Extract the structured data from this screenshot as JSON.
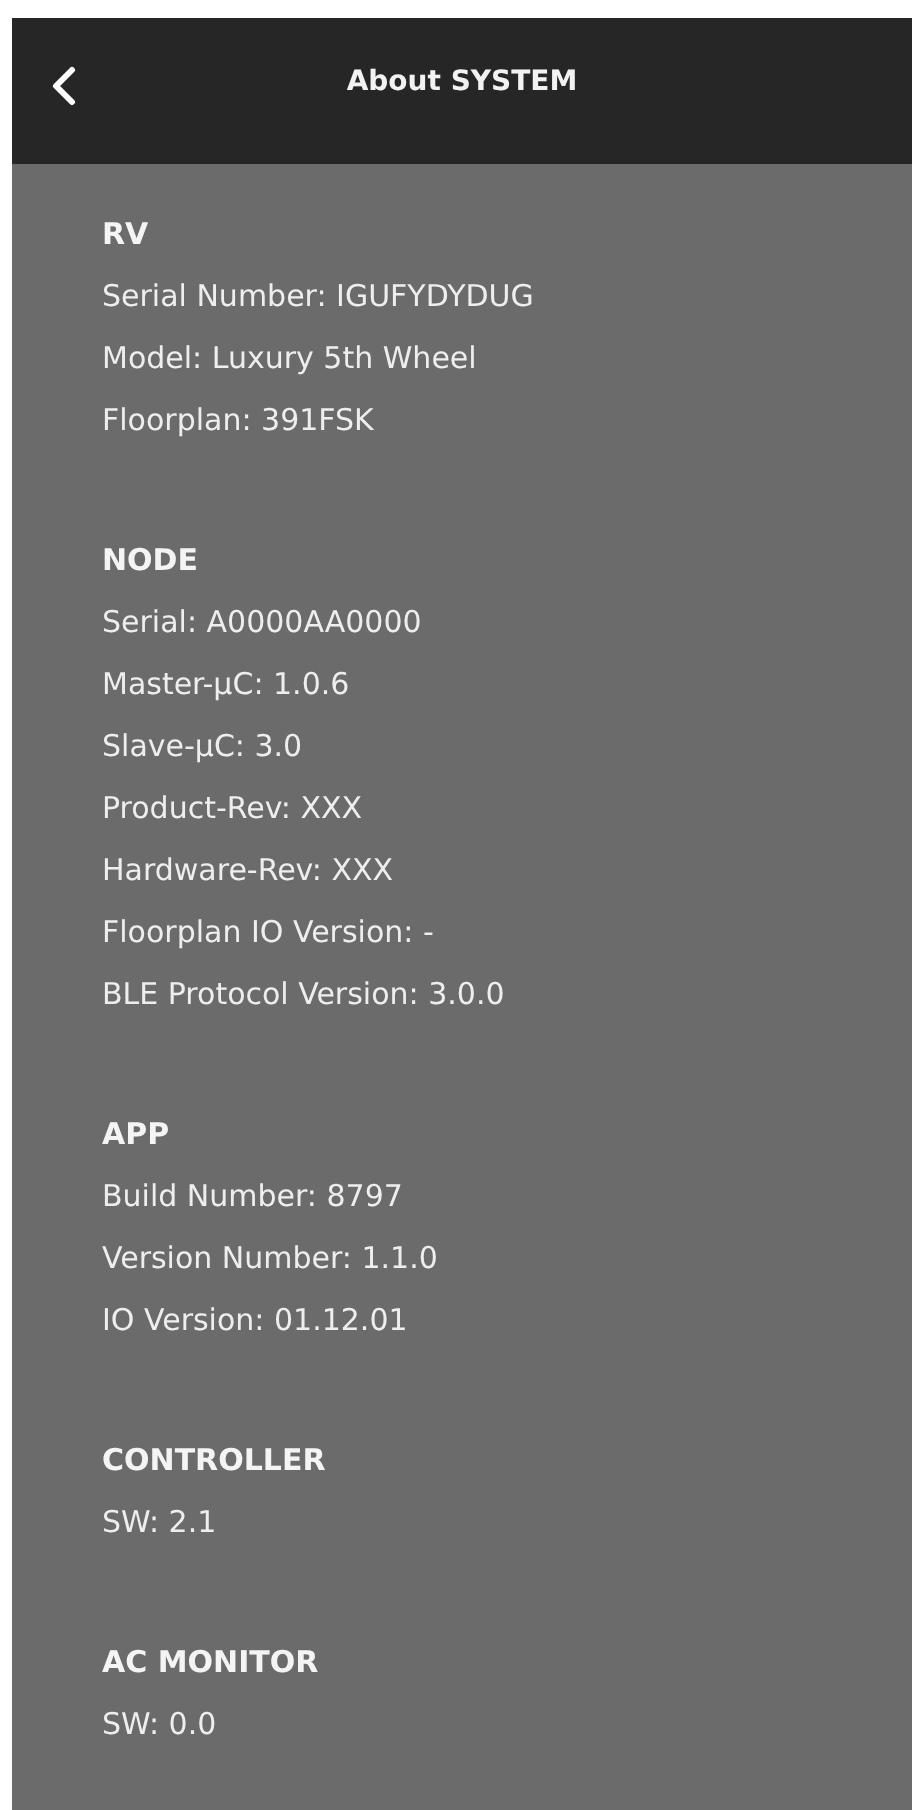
{
  "header": {
    "title": "About SYSTEM"
  },
  "sections": [
    {
      "title": "RV",
      "lines": [
        "Serial Number: IGUFYDYDUG",
        "Model: Luxury 5th Wheel",
        "Floorplan: 391FSK"
      ]
    },
    {
      "title": "NODE",
      "lines": [
        "Serial: A0000AA0000",
        "Master-µC: 1.0.6",
        "Slave-µC: 3.0",
        "Product-Rev: XXX",
        "Hardware-Rev: XXX",
        "Floorplan IO Version: -",
        "BLE Protocol Version: 3.0.0"
      ]
    },
    {
      "title": "APP",
      "lines": [
        "Build Number: 8797",
        "Version Number: 1.1.0",
        "IO Version: 01.12.01"
      ]
    },
    {
      "title": "CONTROLLER",
      "lines": [
        "SW: 2.1"
      ]
    },
    {
      "title": "AC MONITOR",
      "lines": [
        "SW: 0.0"
      ]
    }
  ]
}
